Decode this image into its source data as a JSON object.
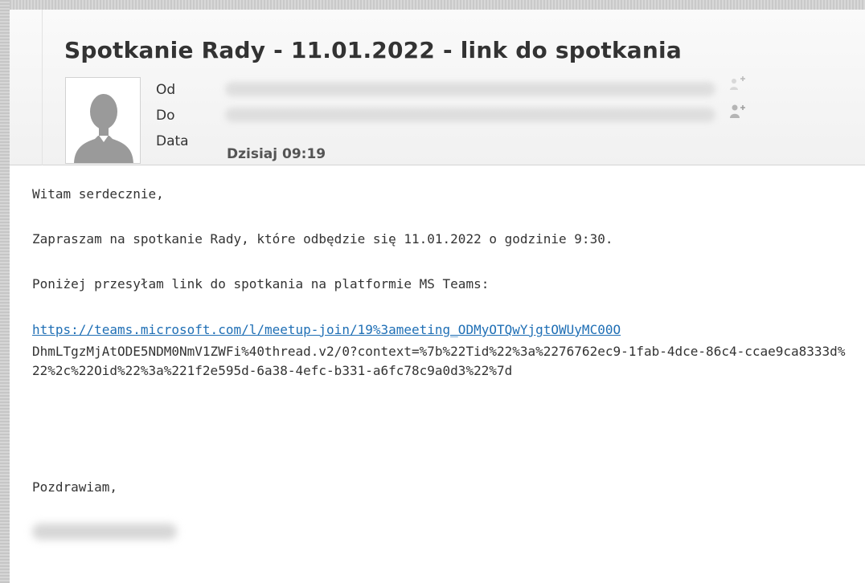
{
  "message": {
    "subject": "Spotkanie Rady - 11.01.2022 - link do spotkania",
    "labels": {
      "from": "Od",
      "to": "Do",
      "date": "Data"
    },
    "date_value": "Dzisiaj 09:19",
    "icons": {
      "avatar": "default-user-avatar",
      "add_contact": "person-add-icon"
    }
  },
  "body": {
    "greeting": "Witam serdecznie,",
    "line1": "Zapraszam na spotkanie Rady, które odbędzie się 11.01.2022 o godzinie 9:30.",
    "line2": "Poniżej przesyłam link do spotkania na platformie MS Teams:",
    "link_text": "https://teams.microsoft.com/l/meetup-join/19%3ameeting_ODMyOTQwYjgtOWUyMC00O",
    "link_rest": "DhmLTgzMjAtODE5NDM0NmV1ZWFi%40thread.v2/0?context=%7b%22Tid%22%3a%2276762ec9-1fab-4dce-86c4-ccae9ca8333d%22%2c%22Oid%22%3a%221f2e595d-6a38-4efc-b331-a6fc78c9a0d3%22%7d",
    "closing": "Pozdrawiam,"
  },
  "colors": {
    "link": "#1f6fb5",
    "text": "#333333",
    "header_bg": "#f3f3f3"
  }
}
